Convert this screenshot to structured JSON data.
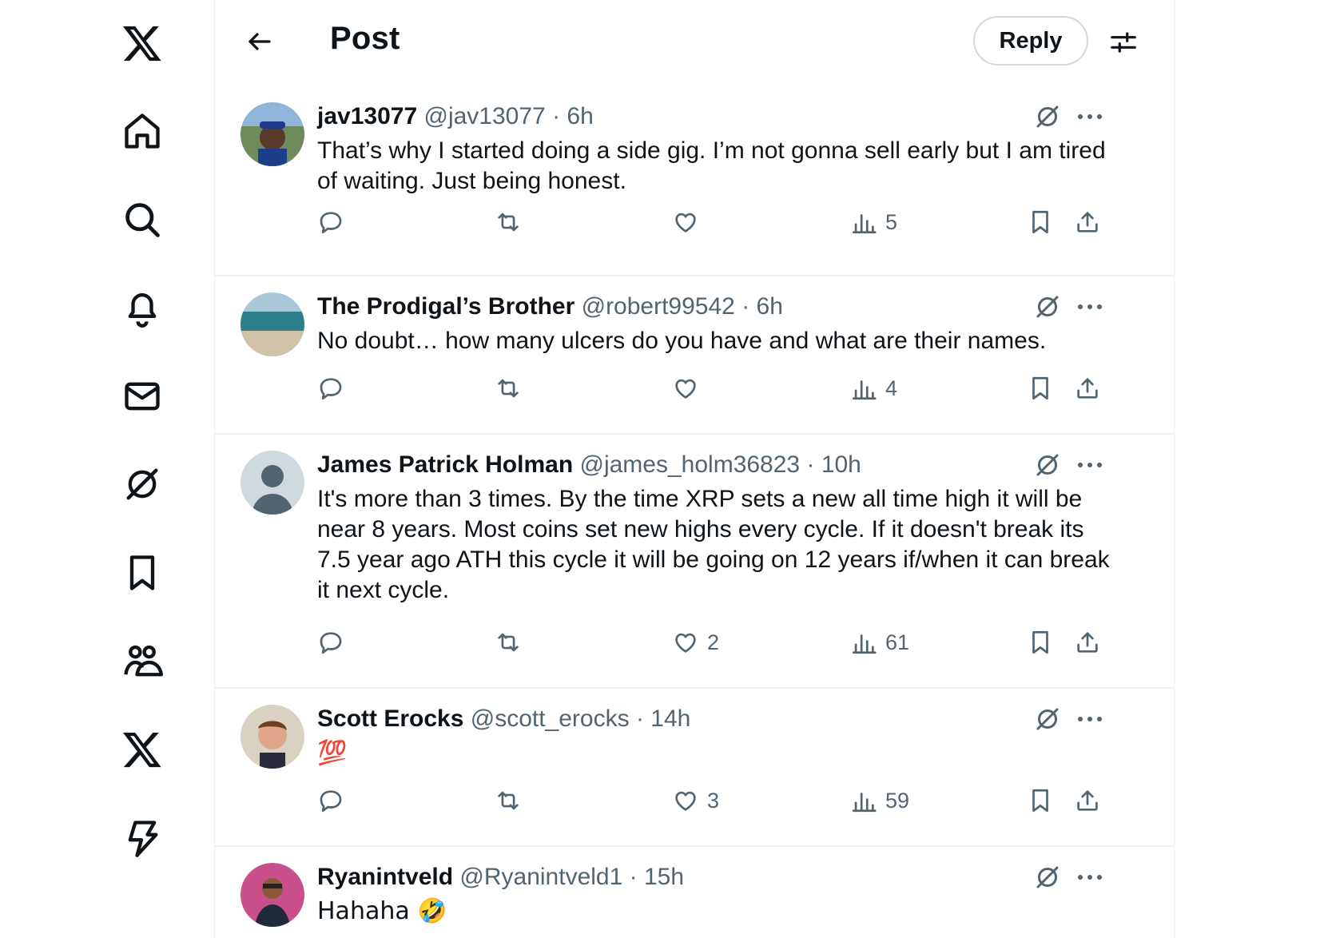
{
  "header": {
    "title": "Post",
    "reply_button": "Reply"
  },
  "nav": {
    "items": [
      {
        "icon": "x-logo-icon"
      },
      {
        "icon": "home-icon"
      },
      {
        "icon": "search-icon"
      },
      {
        "icon": "notifications-bell-icon"
      },
      {
        "icon": "messages-envelope-icon"
      },
      {
        "icon": "grok-icon"
      },
      {
        "icon": "bookmark-icon"
      },
      {
        "icon": "communities-icon"
      },
      {
        "icon": "premium-x-icon"
      },
      {
        "icon": "verified-orgs-bolt-icon"
      }
    ]
  },
  "posts": [
    {
      "name": "jav13077",
      "handle": "@jav13077",
      "time": "6h",
      "text": "That’s why I started doing a side gig. I’m not gonna sell early but I am tired of waiting. Just being honest.",
      "likes": "",
      "views": "5"
    },
    {
      "name": "The Prodigal’s Brother",
      "handle": "@robert99542",
      "time": "6h",
      "text": "No doubt… how many ulcers do you have and what are their names.",
      "likes": "",
      "views": "4"
    },
    {
      "name": "James Patrick Holman",
      "handle": "@james_holm36823",
      "time": "10h",
      "text": "It's more than 3 times. By the time XRP sets a new all time high it will be near 8 years. Most coins set new highs every cycle. If it doesn't break its 7.5 year ago ATH this cycle it will be going on 12 years if/when it can break it next cycle.",
      "likes": "2",
      "views": "61"
    },
    {
      "name": "Scott Erocks",
      "handle": "@scott_erocks",
      "time": "14h",
      "text": "💯",
      "likes": "3",
      "views": "59"
    },
    {
      "name": "Ryanintveld",
      "handle": "@Ryanintveld1",
      "time": "15h",
      "text": "Hahaha 🤣",
      "likes": "",
      "views": ""
    }
  ],
  "colors": {
    "text": "#0f1419",
    "secondary": "#536471",
    "border": "#eff3f4"
  }
}
